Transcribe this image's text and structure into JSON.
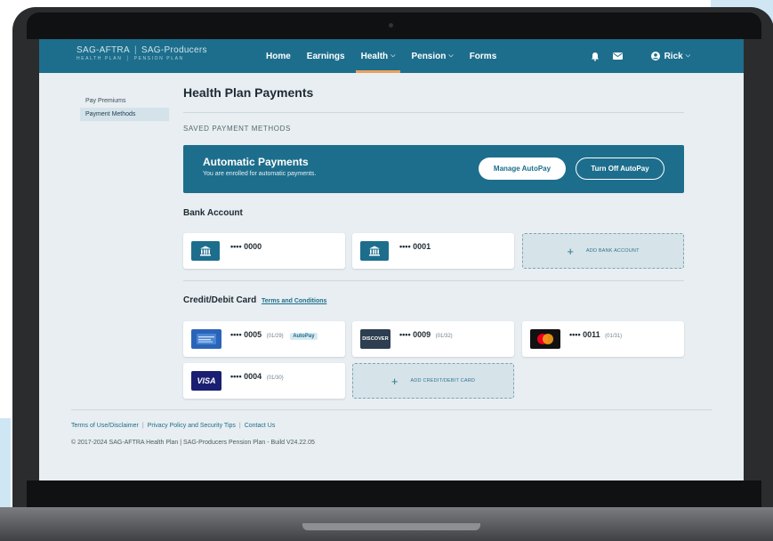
{
  "brand": {
    "name_left": "SAG-AFTRA",
    "sub_left": "HEALTH PLAN",
    "name_right": "SAG-Producers",
    "sub_right": "PENSION PLAN"
  },
  "nav": {
    "items": [
      {
        "label": "Home"
      },
      {
        "label": "Earnings"
      },
      {
        "label": "Health"
      },
      {
        "label": "Pension"
      },
      {
        "label": "Forms"
      }
    ],
    "user": "Rick"
  },
  "sidebar": {
    "items": [
      {
        "label": "Pay Premiums"
      },
      {
        "label": "Payment Methods"
      }
    ]
  },
  "main": {
    "title": "Health Plan Payments",
    "section_label": "SAVED PAYMENT METHODS",
    "autopay": {
      "title": "Automatic Payments",
      "subtitle": "You are enrolled for automatic payments.",
      "manage_label": "Manage AutoPay",
      "off_label": "Turn Off AutoPay"
    },
    "bank": {
      "heading": "Bank Account",
      "accounts": [
        {
          "number": "•••• 0000"
        },
        {
          "number": "•••• 0001"
        }
      ],
      "add_label": "ADD BANK ACCOUNT"
    },
    "cards": {
      "heading": "Credit/Debit Card",
      "terms_link": "Terms and Conditions",
      "items": [
        {
          "brand": "card",
          "number": "•••• 0005",
          "exp": "(01/29)",
          "badge": "AutoPay"
        },
        {
          "brand": "DISCOVER",
          "number": "•••• 0009",
          "exp": "(01/32)"
        },
        {
          "brand": "mastercard",
          "number": "•••• 0011",
          "exp": "(01/31)"
        },
        {
          "brand": "VISA",
          "number": "•••• 0004",
          "exp": "(01/30)"
        }
      ],
      "add_label": "ADD CREDIT/DEBIT CARD"
    }
  },
  "footer": {
    "links": [
      {
        "label": "Terms of Use/Disclaimer"
      },
      {
        "label": "Privacy Policy and Security Tips"
      },
      {
        "label": "Contact Us"
      }
    ],
    "copyright": "© 2017-2024 SAG-AFTRA Health Plan | SAG-Producers Pension Plan - Build V24.22.05"
  },
  "colors": {
    "primary": "#1d6e8c",
    "accent": "#e9a15e",
    "background": "#e8eef1"
  }
}
